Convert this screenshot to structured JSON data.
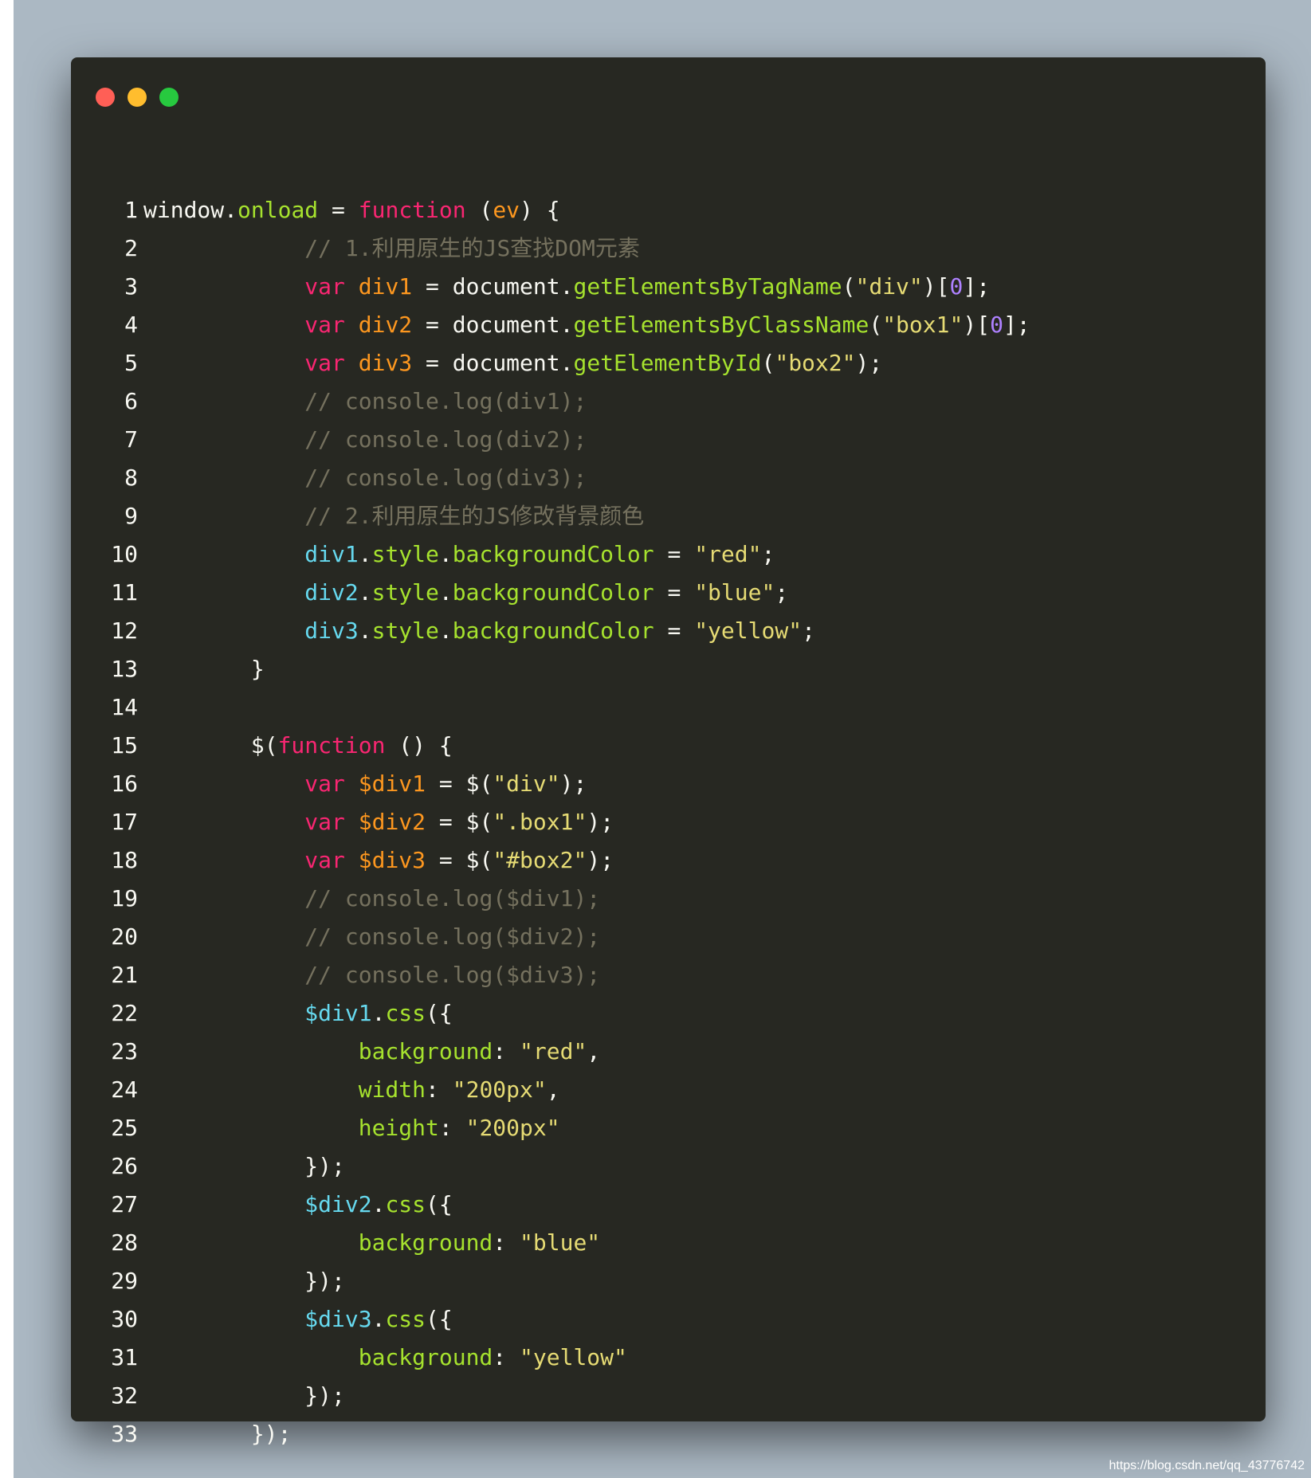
{
  "window": {
    "controls": [
      "close",
      "minimize",
      "maximize"
    ],
    "colors": {
      "background": "#272822",
      "page_background": "#abb8c3",
      "close": "#ff5f56",
      "minimize": "#ffbd2e",
      "maximize": "#27c93f"
    }
  },
  "code": {
    "language": "javascript",
    "lines": [
      {
        "n": "1",
        "tokens": [
          [
            "plain",
            "window."
          ],
          [
            "prop",
            "onload"
          ],
          [
            "plain",
            " = "
          ],
          [
            "keyword",
            "function"
          ],
          [
            "plain",
            " ("
          ],
          [
            "var",
            "ev"
          ],
          [
            "plain",
            ") {"
          ]
        ]
      },
      {
        "n": "2",
        "tokens": [
          [
            "plain",
            "            "
          ],
          [
            "comment",
            "// 1.利用原生的JS查找DOM元素"
          ]
        ]
      },
      {
        "n": "3",
        "tokens": [
          [
            "plain",
            "            "
          ],
          [
            "keyword",
            "var"
          ],
          [
            "plain",
            " "
          ],
          [
            "var",
            "div1"
          ],
          [
            "plain",
            " = document."
          ],
          [
            "prop",
            "getElementsByTagName"
          ],
          [
            "plain",
            "("
          ],
          [
            "string",
            "\"div\""
          ],
          [
            "plain",
            ")["
          ],
          [
            "number",
            "0"
          ],
          [
            "plain",
            "];"
          ]
        ]
      },
      {
        "n": "4",
        "tokens": [
          [
            "plain",
            "            "
          ],
          [
            "keyword",
            "var"
          ],
          [
            "plain",
            " "
          ],
          [
            "var",
            "div2"
          ],
          [
            "plain",
            " = document."
          ],
          [
            "prop",
            "getElementsByClassName"
          ],
          [
            "plain",
            "("
          ],
          [
            "string",
            "\"box1\""
          ],
          [
            "plain",
            ")["
          ],
          [
            "number",
            "0"
          ],
          [
            "plain",
            "];"
          ]
        ]
      },
      {
        "n": "5",
        "tokens": [
          [
            "plain",
            "            "
          ],
          [
            "keyword",
            "var"
          ],
          [
            "plain",
            " "
          ],
          [
            "var",
            "div3"
          ],
          [
            "plain",
            " = document."
          ],
          [
            "prop",
            "getElementById"
          ],
          [
            "plain",
            "("
          ],
          [
            "string",
            "\"box2\""
          ],
          [
            "plain",
            ");"
          ]
        ]
      },
      {
        "n": "6",
        "tokens": [
          [
            "plain",
            "            "
          ],
          [
            "comment",
            "// console.log(div1);"
          ]
        ]
      },
      {
        "n": "7",
        "tokens": [
          [
            "plain",
            "            "
          ],
          [
            "comment",
            "// console.log(div2);"
          ]
        ]
      },
      {
        "n": "8",
        "tokens": [
          [
            "plain",
            "            "
          ],
          [
            "comment",
            "// console.log(div3);"
          ]
        ]
      },
      {
        "n": "9",
        "tokens": [
          [
            "plain",
            "            "
          ],
          [
            "comment",
            "// 2.利用原生的JS修改背景颜色"
          ]
        ]
      },
      {
        "n": "10",
        "tokens": [
          [
            "plain",
            "            "
          ],
          [
            "obj",
            "div1"
          ],
          [
            "plain",
            "."
          ],
          [
            "prop",
            "style"
          ],
          [
            "plain",
            "."
          ],
          [
            "prop",
            "backgroundColor"
          ],
          [
            "plain",
            " = "
          ],
          [
            "string",
            "\"red\""
          ],
          [
            "plain",
            ";"
          ]
        ]
      },
      {
        "n": "11",
        "tokens": [
          [
            "plain",
            "            "
          ],
          [
            "obj",
            "div2"
          ],
          [
            "plain",
            "."
          ],
          [
            "prop",
            "style"
          ],
          [
            "plain",
            "."
          ],
          [
            "prop",
            "backgroundColor"
          ],
          [
            "plain",
            " = "
          ],
          [
            "string",
            "\"blue\""
          ],
          [
            "plain",
            ";"
          ]
        ]
      },
      {
        "n": "12",
        "tokens": [
          [
            "plain",
            "            "
          ],
          [
            "obj",
            "div3"
          ],
          [
            "plain",
            "."
          ],
          [
            "prop",
            "style"
          ],
          [
            "plain",
            "."
          ],
          [
            "prop",
            "backgroundColor"
          ],
          [
            "plain",
            " = "
          ],
          [
            "string",
            "\"yellow\""
          ],
          [
            "plain",
            ";"
          ]
        ]
      },
      {
        "n": "13",
        "tokens": [
          [
            "plain",
            "        }"
          ]
        ]
      },
      {
        "n": "14",
        "tokens": []
      },
      {
        "n": "15",
        "tokens": [
          [
            "plain",
            "        $("
          ],
          [
            "keyword",
            "function"
          ],
          [
            "plain",
            " () {"
          ]
        ]
      },
      {
        "n": "16",
        "tokens": [
          [
            "plain",
            "            "
          ],
          [
            "keyword",
            "var"
          ],
          [
            "plain",
            " "
          ],
          [
            "var",
            "$div1"
          ],
          [
            "plain",
            " = $("
          ],
          [
            "string",
            "\"div\""
          ],
          [
            "plain",
            ");"
          ]
        ]
      },
      {
        "n": "17",
        "tokens": [
          [
            "plain",
            "            "
          ],
          [
            "keyword",
            "var"
          ],
          [
            "plain",
            " "
          ],
          [
            "var",
            "$div2"
          ],
          [
            "plain",
            " = $("
          ],
          [
            "string",
            "\".box1\""
          ],
          [
            "plain",
            ");"
          ]
        ]
      },
      {
        "n": "18",
        "tokens": [
          [
            "plain",
            "            "
          ],
          [
            "keyword",
            "var"
          ],
          [
            "plain",
            " "
          ],
          [
            "var",
            "$div3"
          ],
          [
            "plain",
            " = $("
          ],
          [
            "string",
            "\"#box2\""
          ],
          [
            "plain",
            ");"
          ]
        ]
      },
      {
        "n": "19",
        "tokens": [
          [
            "plain",
            "            "
          ],
          [
            "comment",
            "// console.log($div1);"
          ]
        ]
      },
      {
        "n": "20",
        "tokens": [
          [
            "plain",
            "            "
          ],
          [
            "comment",
            "// console.log($div2);"
          ]
        ]
      },
      {
        "n": "21",
        "tokens": [
          [
            "plain",
            "            "
          ],
          [
            "comment",
            "// console.log($div3);"
          ]
        ]
      },
      {
        "n": "22",
        "tokens": [
          [
            "plain",
            "            "
          ],
          [
            "obj",
            "$div1"
          ],
          [
            "plain",
            "."
          ],
          [
            "prop",
            "css"
          ],
          [
            "plain",
            "({"
          ]
        ]
      },
      {
        "n": "23",
        "tokens": [
          [
            "plain",
            "                "
          ],
          [
            "prop",
            "background"
          ],
          [
            "plain",
            ": "
          ],
          [
            "string",
            "\"red\""
          ],
          [
            "plain",
            ","
          ]
        ]
      },
      {
        "n": "24",
        "tokens": [
          [
            "plain",
            "                "
          ],
          [
            "prop",
            "width"
          ],
          [
            "plain",
            ": "
          ],
          [
            "string",
            "\"200px\""
          ],
          [
            "plain",
            ","
          ]
        ]
      },
      {
        "n": "25",
        "tokens": [
          [
            "plain",
            "                "
          ],
          [
            "prop",
            "height"
          ],
          [
            "plain",
            ": "
          ],
          [
            "string",
            "\"200px\""
          ]
        ]
      },
      {
        "n": "26",
        "tokens": [
          [
            "plain",
            "            });"
          ]
        ]
      },
      {
        "n": "27",
        "tokens": [
          [
            "plain",
            "            "
          ],
          [
            "obj",
            "$div2"
          ],
          [
            "plain",
            "."
          ],
          [
            "prop",
            "css"
          ],
          [
            "plain",
            "({"
          ]
        ]
      },
      {
        "n": "28",
        "tokens": [
          [
            "plain",
            "                "
          ],
          [
            "prop",
            "background"
          ],
          [
            "plain",
            ": "
          ],
          [
            "string",
            "\"blue\""
          ]
        ]
      },
      {
        "n": "29",
        "tokens": [
          [
            "plain",
            "            });"
          ]
        ]
      },
      {
        "n": "30",
        "tokens": [
          [
            "plain",
            "            "
          ],
          [
            "obj",
            "$div3"
          ],
          [
            "plain",
            "."
          ],
          [
            "prop",
            "css"
          ],
          [
            "plain",
            "({"
          ]
        ]
      },
      {
        "n": "31",
        "tokens": [
          [
            "plain",
            "                "
          ],
          [
            "prop",
            "background"
          ],
          [
            "plain",
            ": "
          ],
          [
            "string",
            "\"yellow\""
          ]
        ]
      },
      {
        "n": "32",
        "tokens": [
          [
            "plain",
            "            });"
          ]
        ]
      },
      {
        "n": "33",
        "tokens": [
          [
            "plain",
            "        });"
          ]
        ]
      }
    ]
  },
  "footer": {
    "watermark": "https://blog.csdn.net/qq_43776742"
  }
}
